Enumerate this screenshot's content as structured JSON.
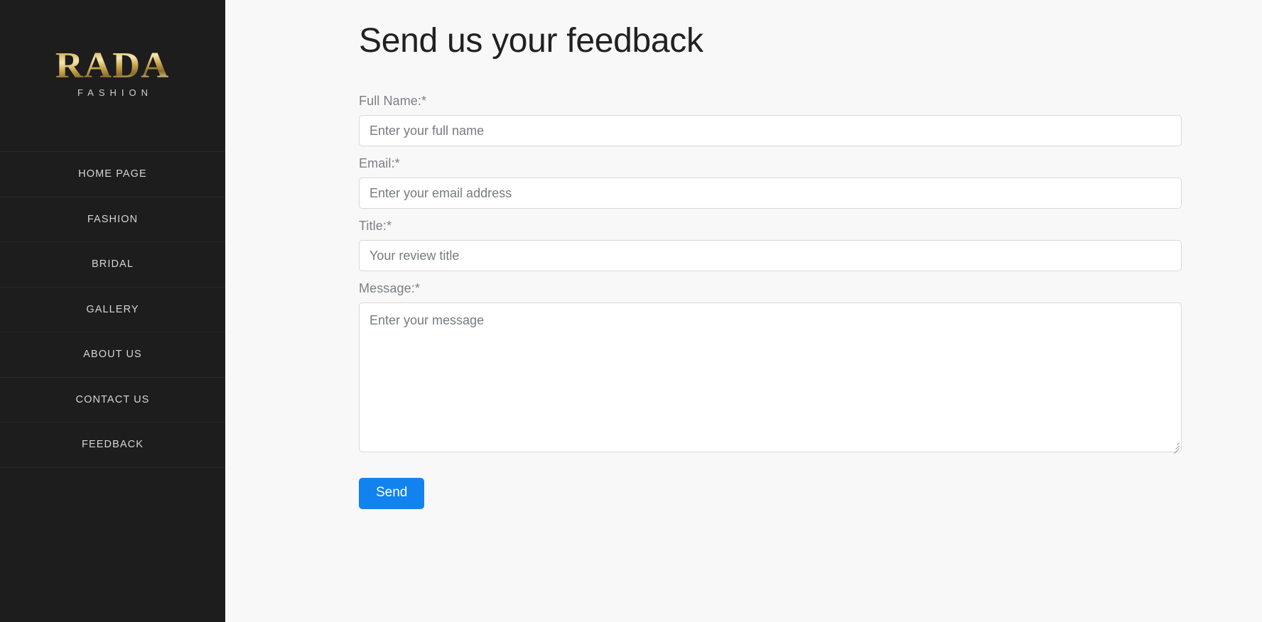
{
  "colors": {
    "sidebar_bg": "#1d1d1d",
    "page_bg": "#f8f8f8",
    "accent_button": "#1283ee",
    "logo_gold_dark": "#7a5f24",
    "logo_gold_light": "#f6e6ac",
    "label_text": "#7a7f85",
    "heading_text": "#212121",
    "input_border": "#d8d8d8"
  },
  "sidebar": {
    "brand": {
      "wordmark": "RADA",
      "tagline": "FASHION"
    },
    "items": [
      {
        "label": "HOME PAGE"
      },
      {
        "label": "FASHION"
      },
      {
        "label": "BRIDAL"
      },
      {
        "label": "GALLERY"
      },
      {
        "label": "ABOUT US"
      },
      {
        "label": "CONTACT US"
      },
      {
        "label": "FEEDBACK"
      }
    ]
  },
  "main": {
    "title": "Send us your feedback",
    "form": {
      "fields": [
        {
          "name": "full-name",
          "label": "Full Name:*",
          "placeholder": "Enter your full name",
          "value": "",
          "type": "text"
        },
        {
          "name": "email",
          "label": "Email:*",
          "placeholder": "Enter your email address",
          "value": "",
          "type": "text"
        },
        {
          "name": "title",
          "label": "Title:*",
          "placeholder": "Your review title",
          "value": "",
          "type": "text"
        },
        {
          "name": "message",
          "label": "Message:*",
          "placeholder": "Enter your message",
          "value": "",
          "type": "textarea"
        }
      ],
      "submit_label": "Send"
    }
  }
}
